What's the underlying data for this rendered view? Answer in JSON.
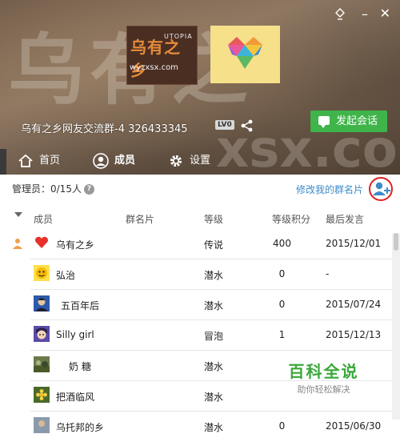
{
  "header": {
    "watermark_main": "乌有之",
    "watermark_url": "xsx.com",
    "logo": {
      "brand": "乌有之乡",
      "brand_small": "UTOPIA",
      "url": "wyzxsx.com"
    },
    "group_title": "乌有之乡网友交流群-4 326433345",
    "level_badge": "LV0",
    "chat_button": "发起会话"
  },
  "tabs": [
    {
      "label": "首页",
      "icon": "house-icon"
    },
    {
      "label": "成员",
      "icon": "person-icon"
    },
    {
      "label": "设置",
      "icon": "gear-icon"
    }
  ],
  "panel": {
    "admins_label": "管理员：0/15人",
    "edit_group_card": "修改我的群名片",
    "columns": [
      "成员",
      "群名片",
      "等级",
      "等级积分",
      "最后发言"
    ],
    "members": [
      {
        "name": "乌有之乡",
        "level": "传说",
        "points": "400",
        "last": "2015/12/01",
        "avatar": "heart"
      },
      {
        "name": "弘治",
        "level": "潜水",
        "points": "0",
        "last": "-",
        "avatar": "yellow-face"
      },
      {
        "name": "五百年后",
        "level": "潜水",
        "points": "0",
        "last": "2015/07/24",
        "avatar": "portrait"
      },
      {
        "name": "Silly girl",
        "level": "冒泡",
        "points": "1",
        "last": "2015/12/13",
        "avatar": "anime-girl"
      },
      {
        "name": "奶 糖",
        "level": "潜水",
        "points": "",
        "last": "",
        "avatar": "scene"
      },
      {
        "name": "把酒临风",
        "level": "潜水",
        "points": "",
        "last": "",
        "avatar": "flower"
      },
      {
        "name": "乌托邦的乡",
        "level": "潜水",
        "points": "0",
        "last": "2015/06/30",
        "avatar": "photo"
      }
    ]
  },
  "watermark_site": {
    "title": "百科全说",
    "subtitle": "助你轻松解决"
  },
  "colors": {
    "accent": "#3fb44a",
    "link": "#3d8bc9",
    "highlight_ring": "#e02020"
  }
}
